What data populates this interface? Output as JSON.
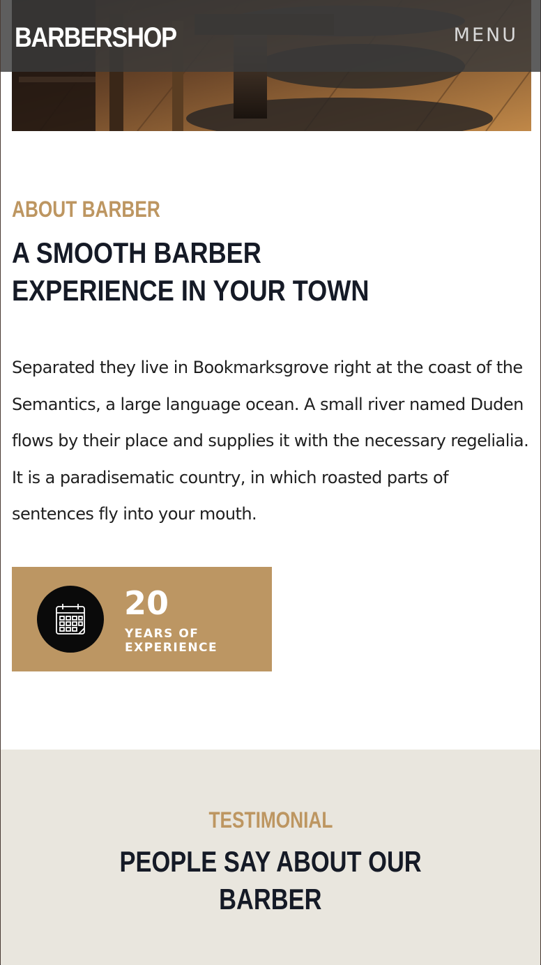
{
  "navbar": {
    "brand": "BARBERSHOP",
    "menu_label": "MENU"
  },
  "about": {
    "eyebrow": "ABOUT BARBER",
    "title_line1": "A SMOOTH BARBER",
    "title_line2": "EXPERIENCE IN YOUR TOWN",
    "body": "Separated they live in Bookmarksgrove right at the coast of the Semantics, a large language ocean. A small river named Duden flows by their place and supplies it with the necessary regelialia. It is a paradisematic country, in which roasted parts of sentences fly into your mouth."
  },
  "experience": {
    "icon": "calendar-icon",
    "number": "20",
    "label_line1": "YEARS OF",
    "label_line2": "EXPERIENCE"
  },
  "testimonial": {
    "eyebrow": "TESTIMONIAL",
    "title_line1": "PEOPLE SAY ABOUT OUR",
    "title_line2": "BARBER"
  },
  "colors": {
    "accent_gold": "#bc9663",
    "heading_dark": "#151a26",
    "testimonial_bg": "#e9e6de",
    "navbar_bg": "#3a3a3a"
  }
}
